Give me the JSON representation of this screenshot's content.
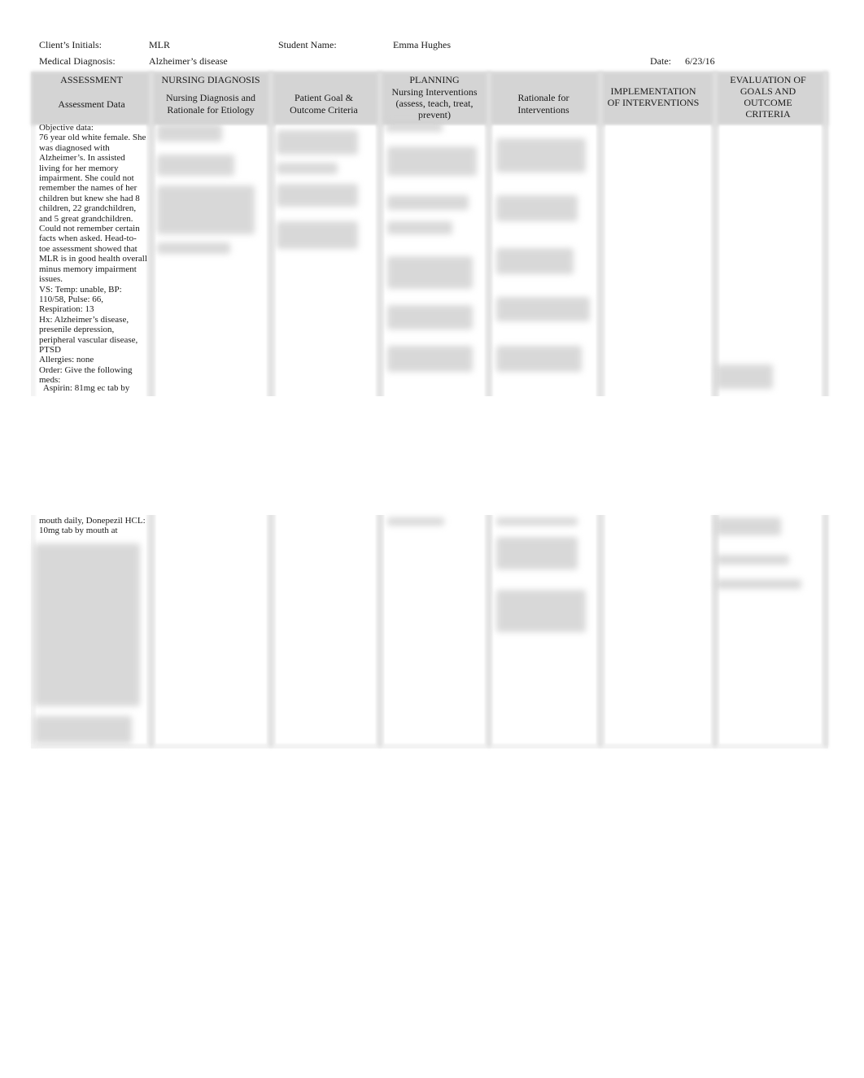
{
  "header": {
    "client_initials_label": "Client’s Initials:",
    "client_initials_value": "MLR",
    "student_name_label": "Student Name:",
    "student_name_value": "Emma Hughes",
    "medical_diagnosis_label": "Medical Diagnosis:",
    "medical_diagnosis_value": "Alzheimer’s disease",
    "date_label": "Date:",
    "date_value": "6/23/16"
  },
  "table": {
    "groups": {
      "assessment": "ASSESSMENT",
      "nursing_diagnosis": "NURSING DIAGNOSIS",
      "planning": "PLANNING",
      "implementation": "IMPLEMENTATION\nOF INTERVENTIONS",
      "evaluation": "EVALUATION OF\nGOALS AND\nOUTCOME\nCRITERIA"
    },
    "columns": {
      "assessment_data": "Assessment Data",
      "nursing_diagnosis_rationale": "Nursing Diagnosis and\nRationale for Etiology",
      "patient_goal": "Patient Goal &\nOutcome Criteria",
      "nursing_interventions": "Nursing Interventions\n(assess, teach, treat,\nprevent)",
      "rationale_interventions": "Rationale for\nInterventions"
    },
    "assessment_text_top": "Objective data:\n76 year old white female.  She\nwas diagnosed with\nAlzheimer’s.  In assisted\nliving for her memory\nimpairment.  She could not\nremember the names of her\nchildren but knew she had 8\nchildren, 22 grandchildren,\nand 5 great grandchildren.\nCould not remember certain\nfacts when asked.  Head-to-\ntoe assessment showed that\nMLR is in good health overall\nminus memory impairment\nissues.\nVS:  Temp: unable,  BP:\n110/58,    Pulse: 66,\nRespiration: 13\nHx:  Alzheimer’s disease,\npresenile depression,\nperipheral vascular disease,\nPTSD\nAllergies:  none\nOrder:   Give the following\nmeds:",
    "assessment_text_aspirin": "  Aspirin: 81mg ec tab by",
    "assessment_text_bottom": "mouth daily, Donepezil HCL:\n10mg tab by mouth at"
  }
}
